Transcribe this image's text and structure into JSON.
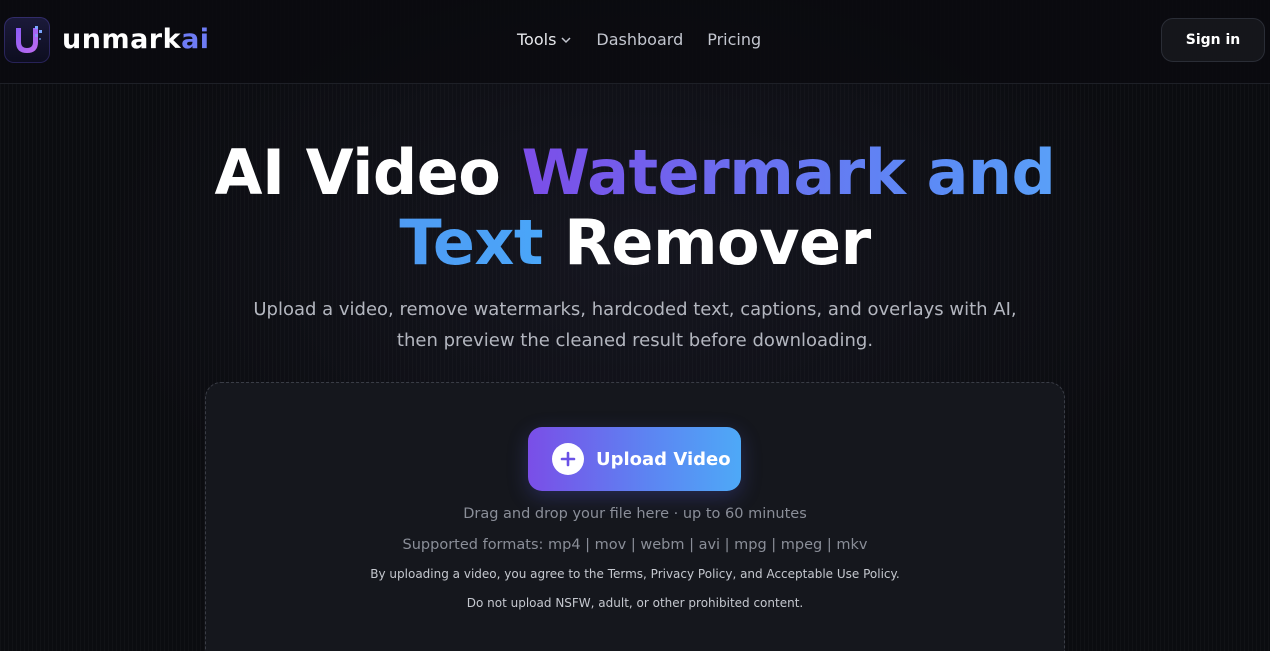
{
  "header": {
    "logo_main": "unmark",
    "logo_accent": "ai",
    "nav": {
      "tools": "Tools",
      "dashboard": "Dashboard",
      "pricing": "Pricing"
    },
    "signin": "Sign in"
  },
  "hero": {
    "title_part1": "AI Video ",
    "title_part2": "Watermark and",
    "title_part3": "Text",
    "title_part4": " Remover",
    "subtitle_line1": "Upload a video, remove watermarks, hardcoded text, captions, and overlays with AI,",
    "subtitle_line2": "then preview the cleaned result before downloading."
  },
  "upload": {
    "button_label": "Upload Video",
    "drag_text": "Drag and drop your file here · up to 60 minutes",
    "formats_text": "Supported formats: mp4 | mov | webm | avi | mpg | mpeg | mkv",
    "legal_text": "By uploading a video, you agree to the Terms, Privacy Policy, and Acceptable Use Policy.",
    "nsfw_text": "Do not upload NSFW, adult, or other prohibited content."
  },
  "colors": {
    "accent_purple": "#7a4ee7",
    "accent_blue": "#4ea9f7",
    "background": "#0b0c10"
  },
  "icons": {
    "logo": "unmark-u-logo-icon",
    "tools_caret": "chevron-down-icon",
    "upload": "plus-icon"
  }
}
